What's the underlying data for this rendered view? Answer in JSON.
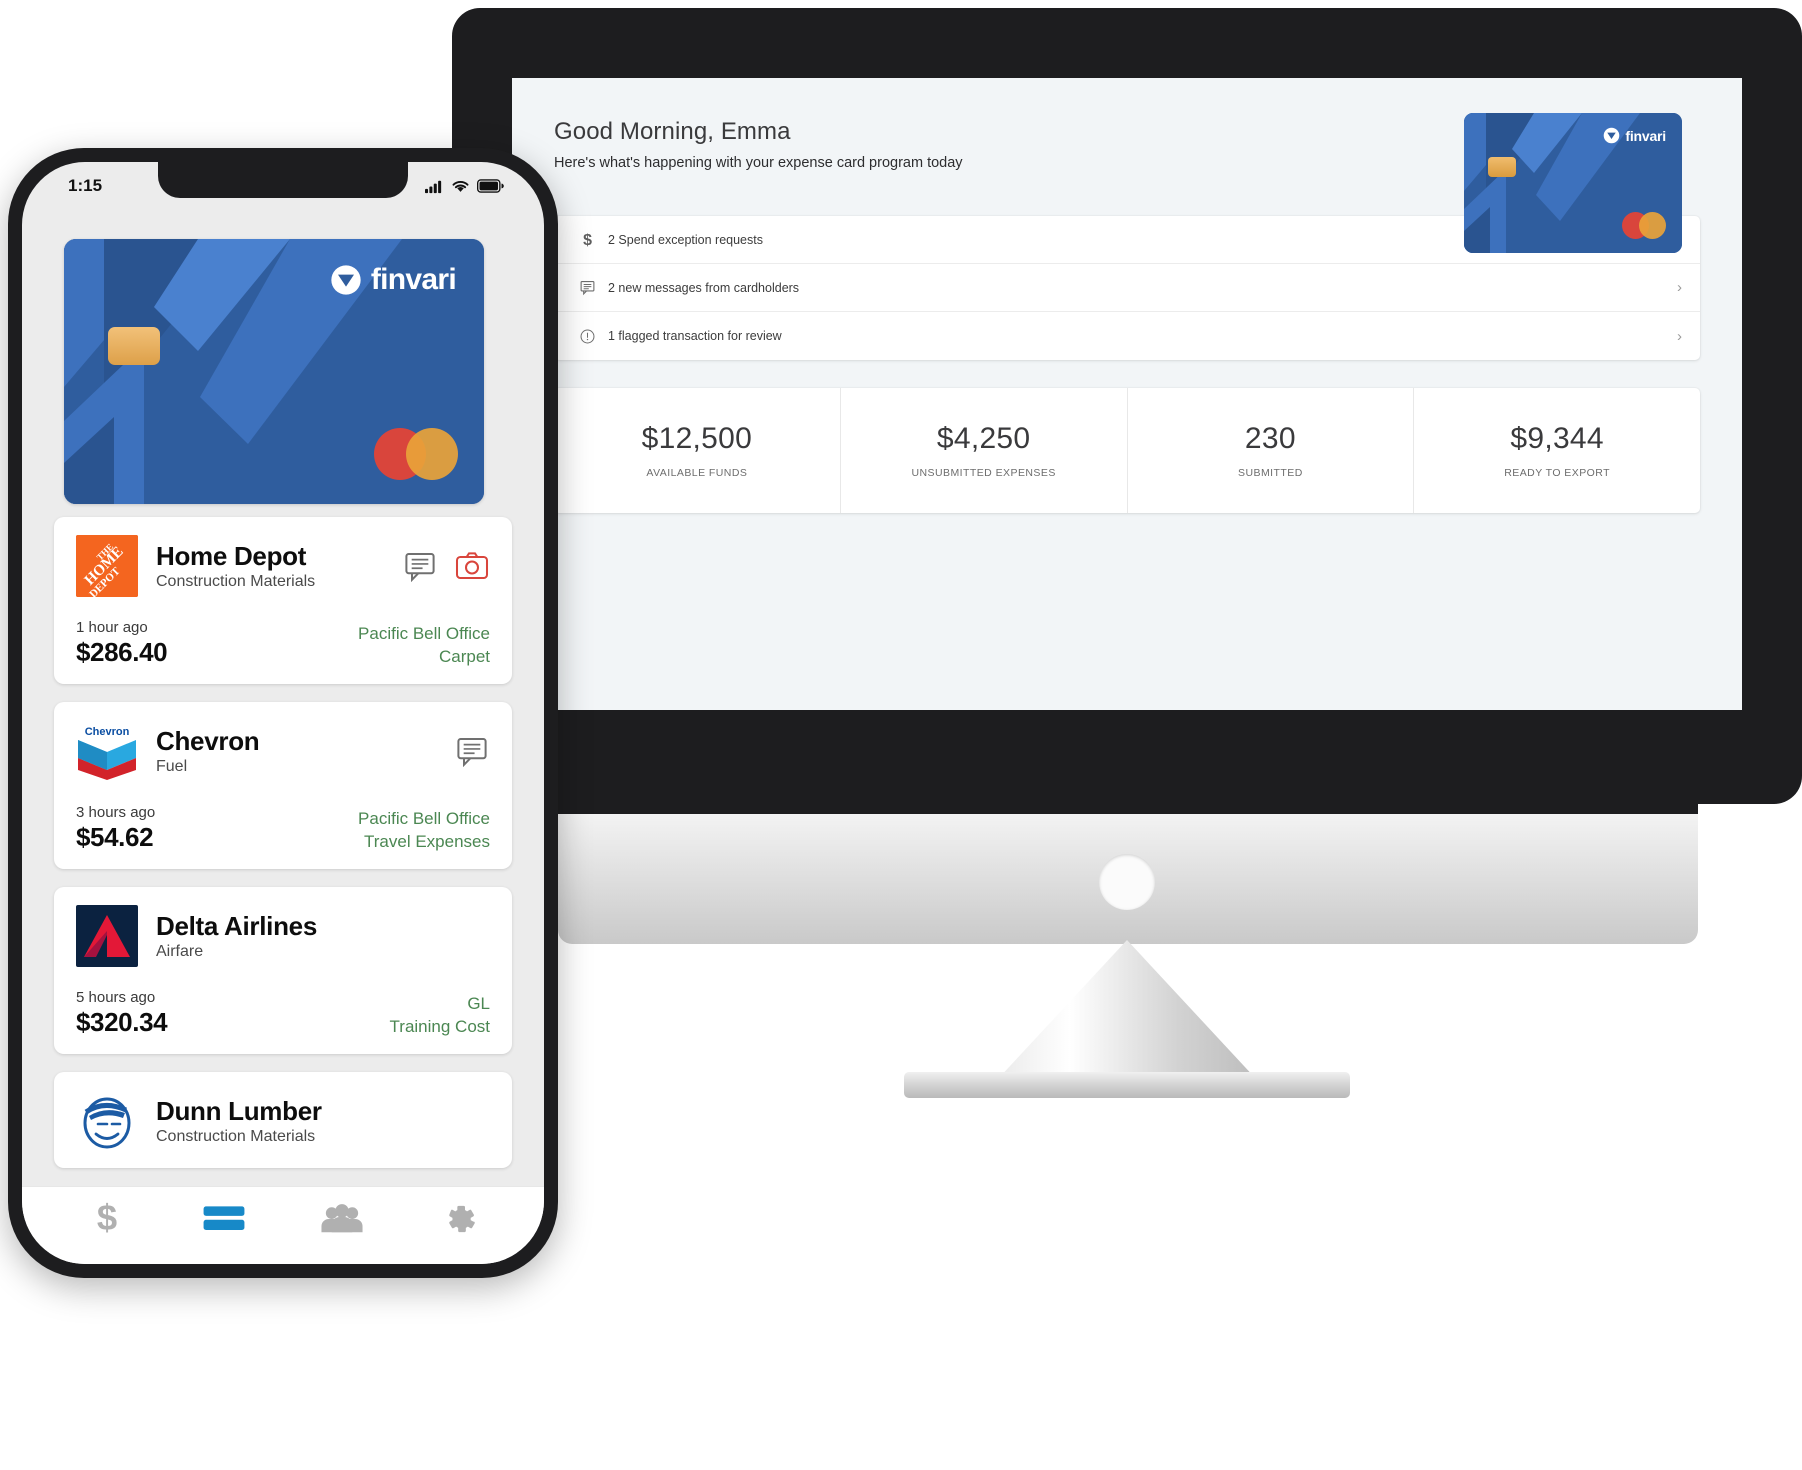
{
  "brand": {
    "name": "finvari",
    "card_blue": "#2f5d9e",
    "accent_green": "#4b8752"
  },
  "desktop": {
    "greeting": "Good Morning, Emma",
    "subtitle": "Here's what's happening with your expense card program today",
    "hero_card": {
      "brand": "finvari",
      "network": "mastercard-logo"
    },
    "notifications": [
      {
        "icon": "dollar-icon",
        "text": "2 Spend exception requests",
        "chevron": "›"
      },
      {
        "icon": "message-icon",
        "text": "2 new messages from cardholders",
        "chevron": "›"
      },
      {
        "icon": "alert-icon",
        "text": "1 flagged transaction for review",
        "chevron": "›"
      }
    ],
    "stats": [
      {
        "value": "$12,500",
        "label": "AVAILABLE FUNDS"
      },
      {
        "value": "$4,250",
        "label": "UNSUBMITTED EXPENSES"
      },
      {
        "value": "230",
        "label": "SUBMITTED"
      },
      {
        "value": "$9,344",
        "label": "READY TO EXPORT"
      }
    ]
  },
  "phone": {
    "status": {
      "time": "1:15",
      "signal": "cellular-signal-icon",
      "wifi": "wifi-icon",
      "battery": "battery-icon"
    },
    "card": {
      "brand": "finvari",
      "network": "mastercard-logo"
    },
    "transactions": [
      {
        "merchant": "Home Depot",
        "category": "Construction Materials",
        "logo": "home-depot-logo",
        "time": "1 hour ago",
        "amount": "$286.40",
        "tag_line1": "Pacific Bell Office",
        "tag_line2": "Carpet",
        "actions": [
          "message-icon",
          "camera-icon"
        ]
      },
      {
        "merchant": "Chevron",
        "category": "Fuel",
        "logo": "chevron-logo",
        "time": "3 hours ago",
        "amount": "$54.62",
        "tag_line1": "Pacific Bell Office",
        "tag_line2": "Travel Expenses",
        "actions": [
          "message-icon"
        ]
      },
      {
        "merchant": "Delta Airlines",
        "category": "Airfare",
        "logo": "delta-logo",
        "time": "5 hours ago",
        "amount": "$320.34",
        "tag_line1": "GL",
        "tag_line2": "Training Cost",
        "actions": []
      },
      {
        "merchant": "Dunn Lumber",
        "category": "Construction Materials",
        "logo": "dunn-lumber-logo",
        "time": "",
        "amount": "",
        "tag_line1": "",
        "tag_line2": "",
        "actions": []
      }
    ],
    "tabs": [
      {
        "icon": "dollar-icon",
        "active": false
      },
      {
        "icon": "card-icon",
        "active": true
      },
      {
        "icon": "people-icon",
        "active": false
      },
      {
        "icon": "gear-icon",
        "active": false
      }
    ]
  }
}
